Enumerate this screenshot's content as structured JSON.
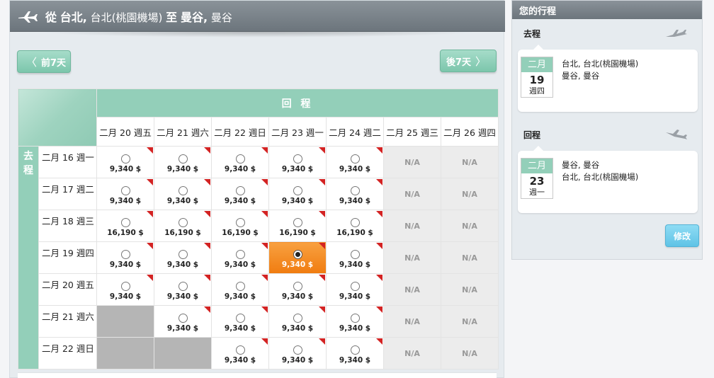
{
  "header": {
    "from_word": "從",
    "origin_city": "台北,",
    "origin_detail": "台北(桃園機場)",
    "to_word": "至",
    "dest_city": "曼谷,",
    "dest_detail": "曼谷"
  },
  "nav": {
    "prev_label": "前7天",
    "next_label": "後7天",
    "prev_arrow": "〈",
    "next_arrow": "〉"
  },
  "grid": {
    "return_label": "回 程",
    "outbound_label": "去\n程",
    "return_dates": [
      "二月 20 週五",
      "二月 21 週六",
      "二月 22 週日",
      "二月 23 週一",
      "二月 24 週二",
      "二月 25 週三",
      "二月 26 週四"
    ],
    "rows": [
      {
        "date": "二月 16 週一",
        "cells": [
          "9,340 $",
          "9,340 $",
          "9,340 $",
          "9,340 $",
          "9,340 $",
          "N/A",
          "N/A"
        ]
      },
      {
        "date": "二月 17 週二",
        "cells": [
          "9,340 $",
          "9,340 $",
          "9,340 $",
          "9,340 $",
          "9,340 $",
          "N/A",
          "N/A"
        ]
      },
      {
        "date": "二月 18 週三",
        "cells": [
          "16,190 $",
          "16,190 $",
          "16,190 $",
          "16,190 $",
          "16,190 $",
          "N/A",
          "N/A"
        ]
      },
      {
        "date": "二月 19 週四",
        "cells": [
          "9,340 $",
          "9,340 $",
          "9,340 $",
          "9,340 $",
          "9,340 $",
          "N/A",
          "N/A"
        ]
      },
      {
        "date": "二月 20 週五",
        "cells": [
          "9,340 $",
          "9,340 $",
          "9,340 $",
          "9,340 $",
          "9,340 $",
          "N/A",
          "N/A"
        ]
      },
      {
        "date": "二月 21 週六",
        "cells": [
          "",
          "9,340 $",
          "9,340 $",
          "9,340 $",
          "9,340 $",
          "N/A",
          "N/A"
        ]
      },
      {
        "date": "二月 22 週日",
        "cells": [
          "",
          "",
          "9,340 $",
          "9,340 $",
          "9,340 $",
          "N/A",
          "N/A"
        ]
      }
    ],
    "selected": {
      "row": 3,
      "col": 3
    }
  },
  "itinerary": {
    "title": "您的行程",
    "outbound": {
      "label": "去程",
      "month": "二月",
      "day": "19",
      "weekday": "週四",
      "from": "台北, 台北(桃園機場)",
      "to": "曼谷, 曼谷"
    },
    "return": {
      "label": "回程",
      "month": "二月",
      "day": "23",
      "weekday": "週一",
      "from": "曼谷, 曼谷",
      "to": "台北, 台北(桃園機場)"
    },
    "edit_label": "修改"
  },
  "icons": {
    "header": "airplane-icon",
    "outbound": "airplane-takeoff-icon",
    "return": "airplane-landing-icon"
  },
  "colors": {
    "accent_green": "#93cfb9",
    "selected_orange": "#f07c10",
    "na_gray": "#ececec",
    "edit_blue": "#5fc3e6",
    "flag_red": "#d32323"
  }
}
